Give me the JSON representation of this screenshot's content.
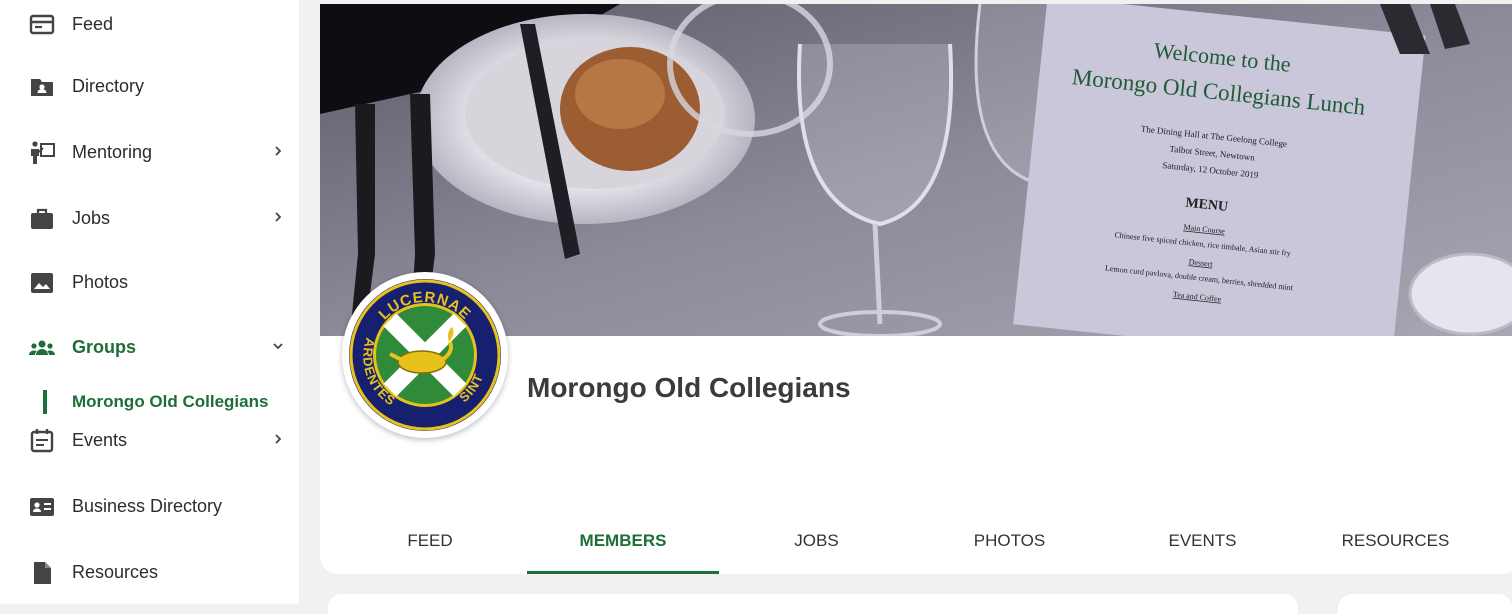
{
  "sidebar": {
    "items": [
      {
        "label": "Feed",
        "icon": "feed-icon"
      },
      {
        "label": "Directory",
        "icon": "directory-icon"
      },
      {
        "label": "Mentoring",
        "icon": "mentoring-icon",
        "chevron": "chevron-right-icon"
      },
      {
        "label": "Jobs",
        "icon": "briefcase-icon",
        "chevron": "chevron-right-icon"
      },
      {
        "label": "Photos",
        "icon": "photo-icon"
      },
      {
        "label": "Groups",
        "icon": "groups-icon",
        "chevron": "chevron-down-icon"
      },
      {
        "label": "Events",
        "icon": "calendar-icon",
        "chevron": "chevron-right-icon"
      },
      {
        "label": "Business Directory",
        "icon": "business-card-icon"
      },
      {
        "label": "Resources",
        "icon": "document-icon"
      }
    ],
    "sub_item": {
      "label": "Morongo Old Collegians"
    }
  },
  "group": {
    "title": "Morongo Old Collegians",
    "logo_text_top": "LUCERNAE",
    "logo_text_right": "ARDENTES",
    "logo_text_left": "SINT"
  },
  "cover": {
    "menu_heading_1": "Welcome to the",
    "menu_heading_2": "Morongo Old Collegians Lunch",
    "venue_1": "The Dining Hall at The Geelong College",
    "venue_2": "Talbot Street, Newtown",
    "venue_3": "Saturday, 12 October 2019",
    "menu_title": "MENU",
    "main_course_label": "Main Course",
    "main_course": "Chinese five spiced chicken, rice timbale, Asian stir fry",
    "dessert_label": "Dessert",
    "dessert": "Lemon curd pavlova, double cream, berries, shredded mint",
    "tea_label": "Tea and Coffee"
  },
  "tabs": [
    {
      "label": "FEED"
    },
    {
      "label": "MEMBERS",
      "active": true
    },
    {
      "label": "JOBS"
    },
    {
      "label": "PHOTOS"
    },
    {
      "label": "EVENTS"
    },
    {
      "label": "RESOURCES"
    }
  ],
  "colors": {
    "accent": "#1d6e38",
    "sidebar_bg": "#ffffff",
    "page_bg": "#f1f1f1"
  }
}
